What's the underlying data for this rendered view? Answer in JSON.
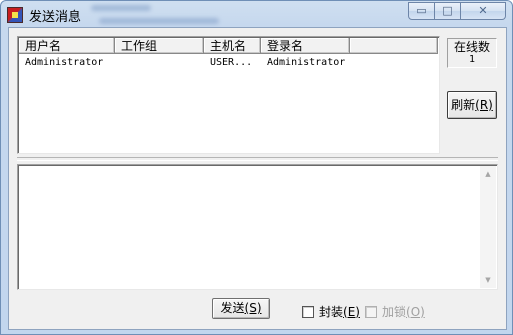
{
  "window": {
    "title": "发送消息",
    "minimize_glyph": "▭",
    "maximize_glyph": "□",
    "close_glyph": "✕"
  },
  "user_list": {
    "columns": [
      "用户名",
      "工作组",
      "主机名",
      "登录名"
    ],
    "rows": [
      [
        "Administrator",
        "",
        "USER...",
        "Administrator"
      ]
    ]
  },
  "online": {
    "label": "在线数",
    "count": "1"
  },
  "buttons": {
    "refresh_label": "刷新",
    "refresh_hotkey": "(R)",
    "send_label": "发送",
    "send_hotkey": "(S)"
  },
  "message": {
    "value": ""
  },
  "options": {
    "encapsulate_label": "封装",
    "encapsulate_hotkey": "(E)",
    "encrypt_label": "加锁",
    "encrypt_hotkey": "(O)"
  }
}
